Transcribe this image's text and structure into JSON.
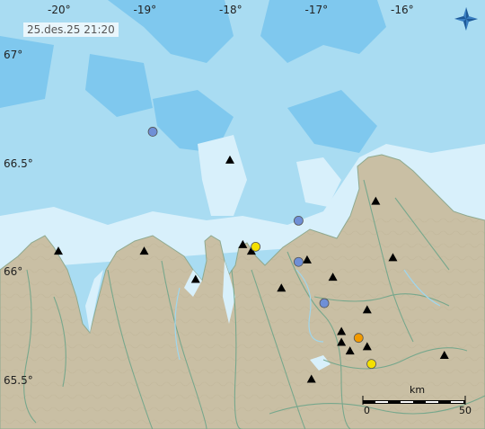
{
  "timestamp": "25.des.25  21:20",
  "longitude_labels": [
    {
      "label": "-20°",
      "lon": -20
    },
    {
      "label": "-19°",
      "lon": -19
    },
    {
      "label": "-18°",
      "lon": -18
    },
    {
      "label": "-17°",
      "lon": -17
    },
    {
      "label": "-16°",
      "lon": -16
    }
  ],
  "latitude_labels": [
    {
      "label": "67°",
      "lat": 67
    },
    {
      "label": "66.5°",
      "lat": 66.5
    },
    {
      "label": "66°",
      "lat": 66
    },
    {
      "label": "65.5°",
      "lat": 65.5
    }
  ],
  "scale_bar": {
    "unit": "km",
    "start": "0",
    "end": "50"
  },
  "colors": {
    "sea_deep": "#7fc8ee",
    "sea_mid": "#a9dcf2",
    "sea_shallow": "#d8f0fb",
    "land": "#c9bfa4",
    "contour": "#6fa58a",
    "station": "#000000",
    "quake_blue": "#6f8fd6",
    "quake_yellow": "#f4e000",
    "quake_orange": "#f29a00"
  },
  "stations": [
    {
      "lon": -20.0,
      "lat": 66.1
    },
    {
      "lon": -19.0,
      "lat": 66.1
    },
    {
      "lon": -18.4,
      "lat": 65.97
    },
    {
      "lon": -18.0,
      "lat": 66.52
    },
    {
      "lon": -17.85,
      "lat": 66.13
    },
    {
      "lon": -17.75,
      "lat": 66.1
    },
    {
      "lon": -17.4,
      "lat": 65.93
    },
    {
      "lon": -17.1,
      "lat": 66.06
    },
    {
      "lon": -16.8,
      "lat": 65.98
    },
    {
      "lon": -16.4,
      "lat": 65.83
    },
    {
      "lon": -16.3,
      "lat": 66.33
    },
    {
      "lon": -16.1,
      "lat": 66.07
    },
    {
      "lon": -16.7,
      "lat": 65.73
    },
    {
      "lon": -16.4,
      "lat": 65.66
    },
    {
      "lon": -16.6,
      "lat": 65.64
    },
    {
      "lon": -15.5,
      "lat": 65.62
    },
    {
      "lon": -16.7,
      "lat": 65.68
    },
    {
      "lon": -17.05,
      "lat": 65.51
    }
  ],
  "earthquakes": [
    {
      "lon": -18.9,
      "lat": 66.65,
      "color": "blue"
    },
    {
      "lon": -17.2,
      "lat": 66.24,
      "color": "blue"
    },
    {
      "lon": -17.2,
      "lat": 66.05,
      "color": "blue"
    },
    {
      "lon": -16.9,
      "lat": 65.86,
      "color": "blue"
    },
    {
      "lon": -17.7,
      "lat": 66.12,
      "color": "yellow"
    },
    {
      "lon": -16.5,
      "lat": 65.7,
      "color": "orange"
    },
    {
      "lon": -16.35,
      "lat": 65.58,
      "color": "yellow"
    }
  ]
}
